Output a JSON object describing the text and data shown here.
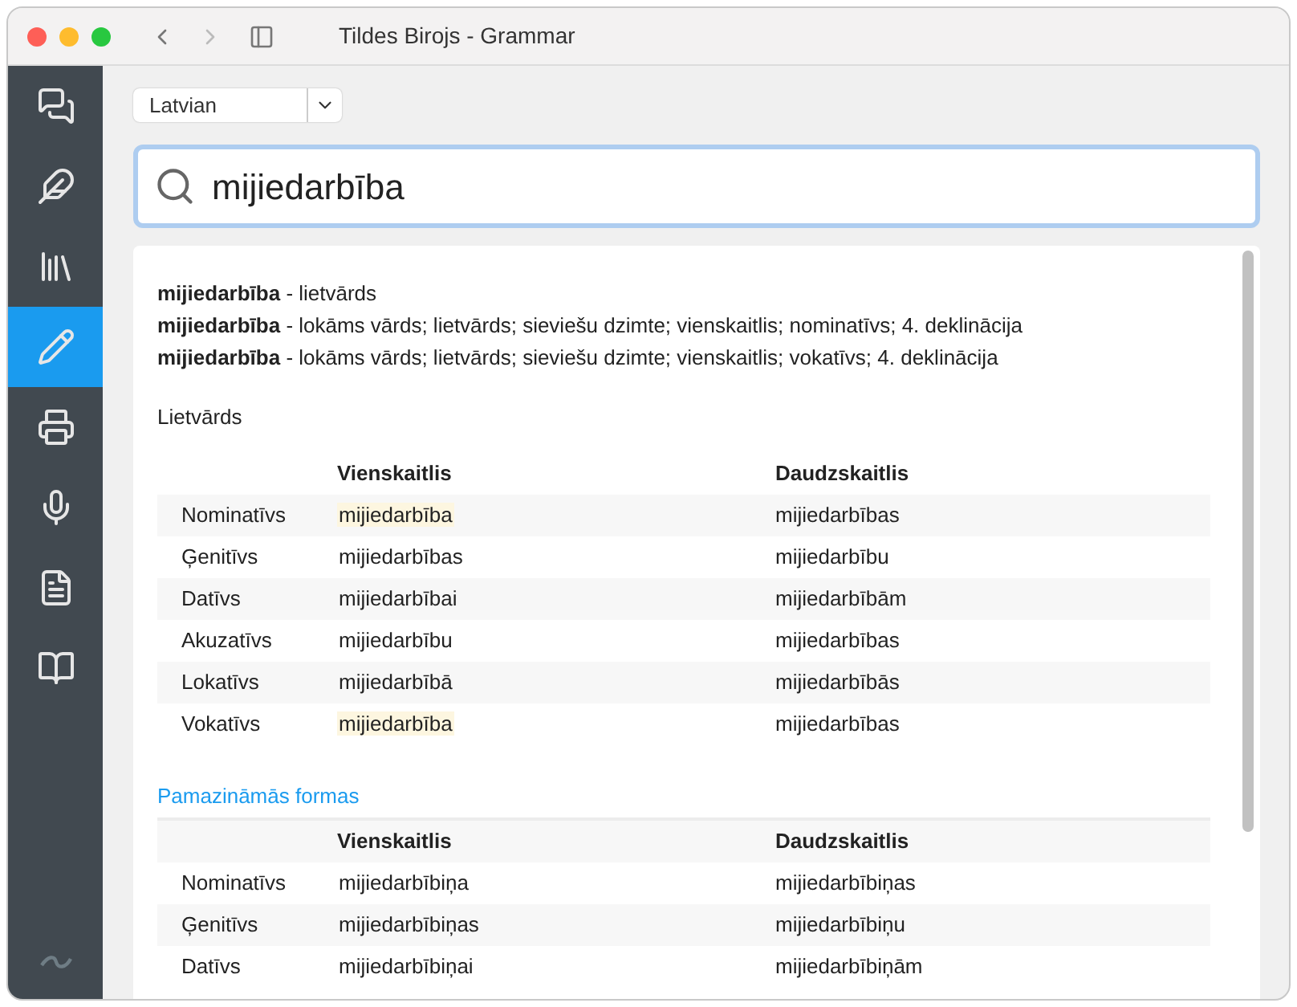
{
  "window": {
    "title": "Tildes Birojs - Grammar"
  },
  "sidebar": {
    "items": [
      {
        "kind": "chat",
        "selected": false
      },
      {
        "kind": "quill",
        "selected": false
      },
      {
        "kind": "books",
        "selected": false
      },
      {
        "kind": "pencil",
        "selected": true
      },
      {
        "kind": "printer",
        "selected": false
      },
      {
        "kind": "mic",
        "selected": false
      },
      {
        "kind": "document",
        "selected": false
      },
      {
        "kind": "book",
        "selected": false
      }
    ]
  },
  "language": {
    "value": "Latvian"
  },
  "search": {
    "value": "mijiedarbība"
  },
  "definitions": [
    "**mijiedarbība** - lietvārds",
    "**mijiedarbība** - lokāms vārds; lietvārds; sieviešu dzimte; vienskaitlis; nominatīvs; 4. deklinācija",
    "**mijiedarbība** - lokāms vārds; lietvārds; sieviešu dzimte; vienskaitlis; vokatīvs; 4. deklinācija"
  ],
  "tables": [
    {
      "title": "Lietvārds",
      "kind": "plain",
      "columns": [
        "Vienskaitlis",
        "Daudzskaitlis"
      ],
      "rows": [
        {
          "case": "Nominatīvs",
          "singular": "mijiedarbība",
          "plural": "mijiedarbības",
          "highlighted": true
        },
        {
          "case": "Ģenitīvs",
          "singular": "mijiedarbības",
          "plural": "mijiedarbību",
          "highlighted": false
        },
        {
          "case": "Datīvs",
          "singular": "mijiedarbībai",
          "plural": "mijiedarbībām",
          "highlighted": false
        },
        {
          "case": "Akuzatīvs",
          "singular": "mijiedarbību",
          "plural": "mijiedarbības",
          "highlighted": false
        },
        {
          "case": "Lokatīvs",
          "singular": "mijiedarbībā",
          "plural": "mijiedarbībās",
          "highlighted": false
        },
        {
          "case": "Vokatīvs",
          "singular": "mijiedarbība",
          "plural": "mijiedarbības",
          "highlighted": true
        }
      ]
    },
    {
      "title": "Pamazināmās formas",
      "kind": "link",
      "columns": [
        "Vienskaitlis",
        "Daudzskaitlis"
      ],
      "rows": [
        {
          "case": "Nominatīvs",
          "singular": "mijiedarbībiņa",
          "plural": "mijiedarbībiņas",
          "highlighted": false
        },
        {
          "case": "Ģenitīvs",
          "singular": "mijiedarbībiņas",
          "plural": "mijiedarbībiņu",
          "highlighted": false
        },
        {
          "case": "Datīvs",
          "singular": "mijiedarbībiņai",
          "plural": "mijiedarbībiņām",
          "highlighted": false
        }
      ]
    }
  ]
}
